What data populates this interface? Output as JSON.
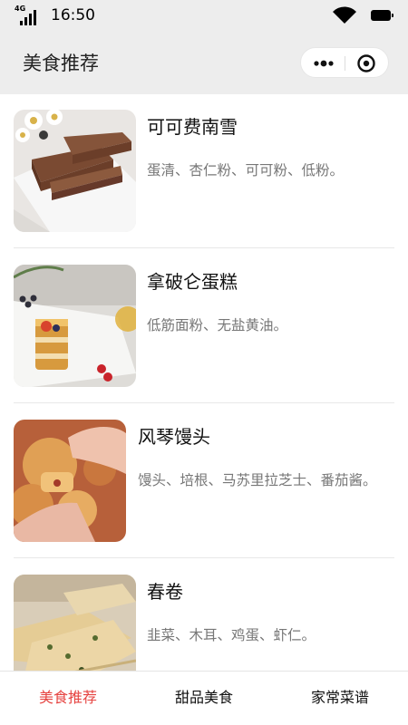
{
  "status_bar": {
    "network": "4G",
    "time": "16:50"
  },
  "nav_bar": {
    "title": "美食推荐"
  },
  "list": {
    "items": [
      {
        "title": "可可费南雪",
        "desc": "蛋清、杏仁粉、可可粉、低粉。",
        "image": "cocoa-financier-photo"
      },
      {
        "title": "拿破仑蛋糕",
        "desc": "低筋面粉、无盐黄油。",
        "image": "napoleon-cake-photo"
      },
      {
        "title": "风琴馒头",
        "desc": "馒头、培根、马苏里拉芝士、番茄酱。",
        "image": "accordion-bun-photo"
      },
      {
        "title": "春卷",
        "desc": "韭菜、木耳、鸡蛋、虾仁。",
        "image": "spring-roll-photo"
      }
    ]
  },
  "tab_bar": {
    "tabs": [
      {
        "label": "美食推荐",
        "active": true
      },
      {
        "label": "甜品美食",
        "active": false
      },
      {
        "label": "家常菜谱",
        "active": false
      }
    ],
    "active_color": "#e64340"
  },
  "colors": {
    "header_bg": "#ededed",
    "title_text": "#111111",
    "desc_text": "#777777"
  }
}
